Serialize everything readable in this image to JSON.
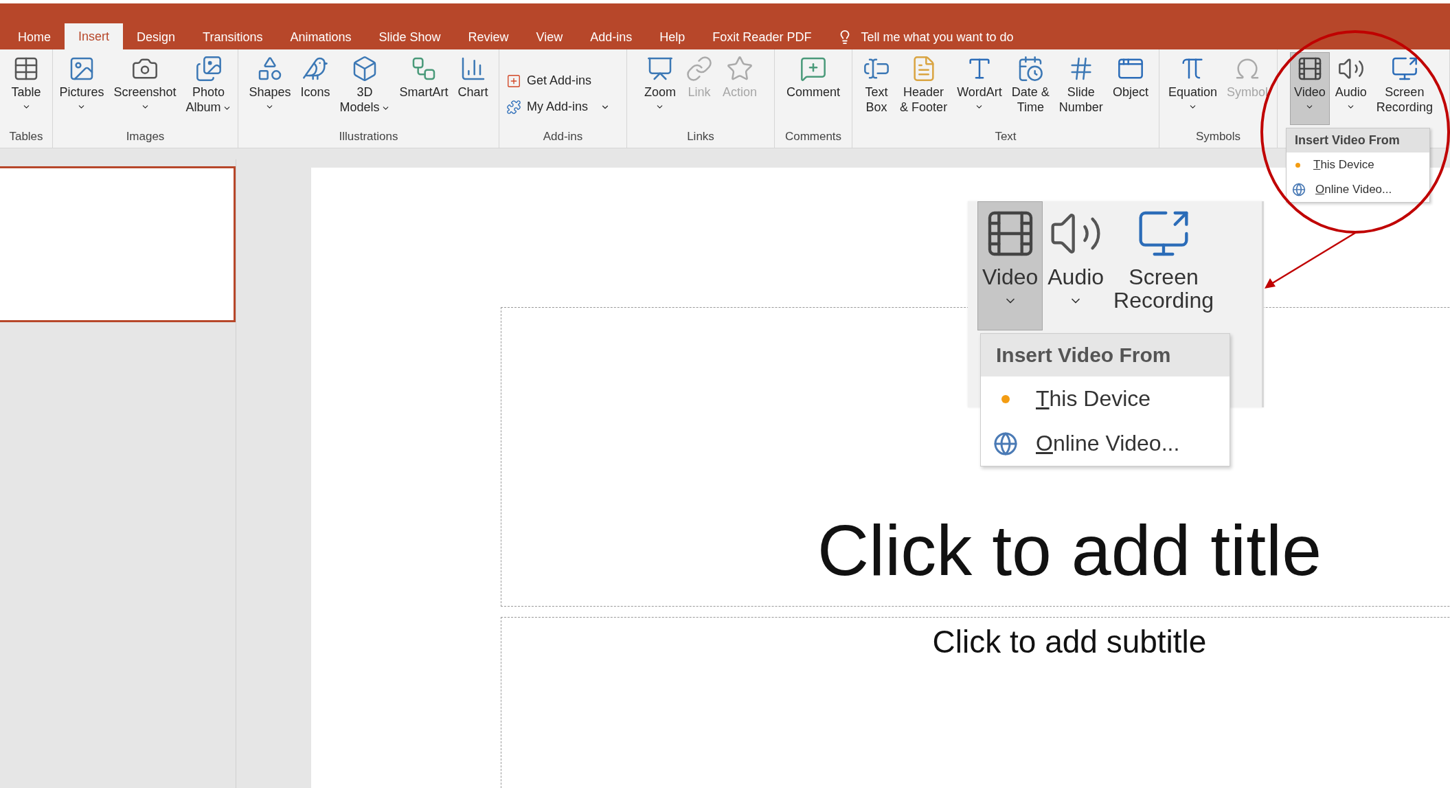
{
  "tabs": [
    {
      "label": "Home",
      "selected": false
    },
    {
      "label": "Insert",
      "selected": true
    },
    {
      "label": "Design",
      "selected": false
    },
    {
      "label": "Transitions",
      "selected": false
    },
    {
      "label": "Animations",
      "selected": false
    },
    {
      "label": "Slide Show",
      "selected": false
    },
    {
      "label": "Review",
      "selected": false
    },
    {
      "label": "View",
      "selected": false
    },
    {
      "label": "Add-ins",
      "selected": false
    },
    {
      "label": "Help",
      "selected": false
    },
    {
      "label": "Foxit Reader PDF",
      "selected": false
    }
  ],
  "tell_me": {
    "text": "Tell me what you want to do"
  },
  "ribbon": {
    "groups": [
      {
        "label": "Tables",
        "buttons": [
          {
            "kind": "large",
            "lines": [
              "Table"
            ],
            "dropdown": true,
            "disabled": false
          }
        ]
      },
      {
        "label": "Images",
        "buttons": [
          {
            "kind": "large",
            "lines": [
              "Pictures"
            ],
            "dropdown": true,
            "disabled": false
          },
          {
            "kind": "large",
            "lines": [
              "Screenshot"
            ],
            "dropdown": true,
            "disabled": false
          },
          {
            "kind": "large",
            "lines": [
              "Photo",
              "Album"
            ],
            "dropdown": true,
            "disabled": false
          }
        ]
      },
      {
        "label": "Illustrations",
        "buttons": [
          {
            "kind": "large",
            "lines": [
              "Shapes"
            ],
            "dropdown": true,
            "disabled": false
          },
          {
            "kind": "large",
            "lines": [
              "Icons"
            ],
            "dropdown": false,
            "disabled": false
          },
          {
            "kind": "large",
            "lines": [
              "3D",
              "Models"
            ],
            "dropdown": true,
            "disabled": false
          },
          {
            "kind": "large",
            "lines": [
              "SmartArt"
            ],
            "dropdown": false,
            "disabled": false
          },
          {
            "kind": "large",
            "lines": [
              "Chart"
            ],
            "dropdown": false,
            "disabled": false
          }
        ]
      },
      {
        "label": "Add-ins",
        "buttons": [
          {
            "kind": "small",
            "lines": [
              "Get Add-ins"
            ],
            "dropdown": false,
            "disabled": false
          },
          {
            "kind": "small",
            "lines": [
              "My Add-ins"
            ],
            "dropdown": true,
            "disabled": false
          }
        ]
      },
      {
        "label": "Links",
        "buttons": [
          {
            "kind": "large",
            "lines": [
              "Zoom"
            ],
            "dropdown": true,
            "disabled": false
          },
          {
            "kind": "large",
            "lines": [
              "Link"
            ],
            "dropdown": false,
            "disabled": true
          },
          {
            "kind": "large",
            "lines": [
              "Action"
            ],
            "dropdown": false,
            "disabled": true
          }
        ]
      },
      {
        "label": "Comments",
        "buttons": [
          {
            "kind": "large",
            "lines": [
              "Comment"
            ],
            "dropdown": false,
            "disabled": false
          }
        ]
      },
      {
        "label": "Text",
        "buttons": [
          {
            "kind": "large",
            "lines": [
              "Text",
              "Box"
            ],
            "dropdown": false,
            "disabled": false
          },
          {
            "kind": "large",
            "lines": [
              "Header",
              "& Footer"
            ],
            "dropdown": false,
            "disabled": false
          },
          {
            "kind": "large",
            "lines": [
              "WordArt"
            ],
            "dropdown": true,
            "disabled": false
          },
          {
            "kind": "large",
            "lines": [
              "Date &",
              "Time"
            ],
            "dropdown": false,
            "disabled": false
          },
          {
            "kind": "large",
            "lines": [
              "Slide",
              "Number"
            ],
            "dropdown": false,
            "disabled": false
          },
          {
            "kind": "large",
            "lines": [
              "Object"
            ],
            "dropdown": false,
            "disabled": false
          }
        ]
      },
      {
        "label": "Symbols",
        "buttons": [
          {
            "kind": "large",
            "lines": [
              "Equation"
            ],
            "dropdown": true,
            "disabled": false
          },
          {
            "kind": "large",
            "lines": [
              "Symbol"
            ],
            "dropdown": false,
            "disabled": true
          }
        ]
      },
      {
        "buttons": [
          {
            "kind": "large",
            "lines": [
              "Video"
            ],
            "dropdown": true,
            "disabled": false,
            "selected": true
          },
          {
            "kind": "large",
            "lines": [
              "Audio"
            ],
            "dropdown": true,
            "disabled": false,
            "selected": false
          },
          {
            "kind": "large",
            "lines": [
              "Screen",
              "Recording"
            ],
            "dropdown": false,
            "disabled": false,
            "selected": false
          }
        ]
      }
    ]
  },
  "video_menu": {
    "header": "Insert Video From",
    "items": [
      {
        "label": "This Device"
      },
      {
        "label": "Online Video..."
      }
    ]
  },
  "thumbnails": [
    {
      "selected": true
    }
  ],
  "slide": {
    "title_placeholder": "Click to add title",
    "subtitle_placeholder": "Click to add subtitle"
  },
  "callout": {
    "buttons": [
      {
        "lines": [
          "Video"
        ],
        "dropdown": true,
        "selected": true
      },
      {
        "lines": [
          "Audio"
        ],
        "dropdown": true,
        "selected": false
      },
      {
        "lines": [
          "Screen",
          "Recording"
        ],
        "dropdown": false,
        "selected": false
      }
    ],
    "menu": {
      "header": "Insert Video From",
      "items": [
        {
          "label": "This Device"
        },
        {
          "label": "Online Video..."
        }
      ]
    }
  }
}
